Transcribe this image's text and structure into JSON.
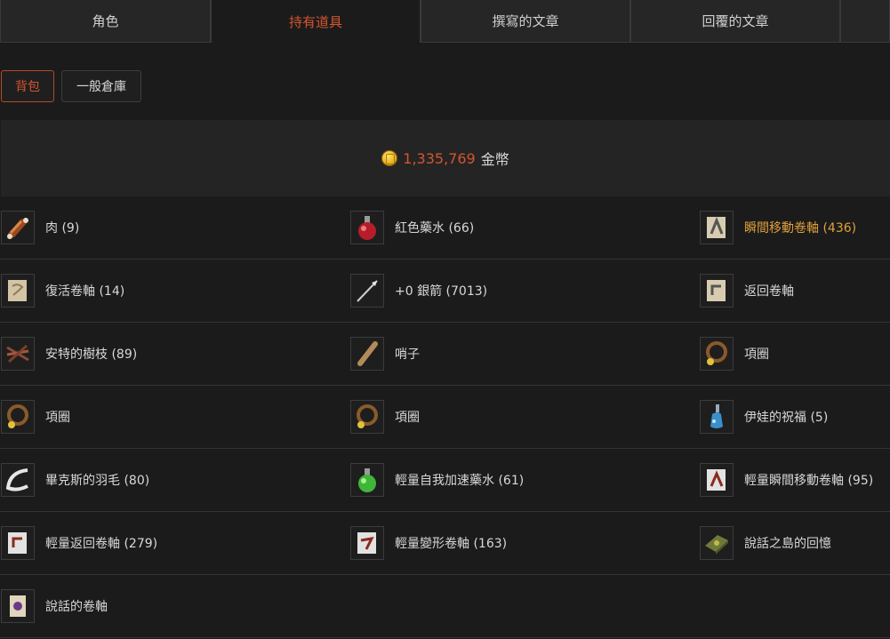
{
  "tabs": [
    "角色",
    "持有道具",
    "撰寫的文章",
    "回覆的文章",
    ""
  ],
  "subtabs": [
    "背包",
    "一般倉庫"
  ],
  "gold": {
    "amount": "1,335,769",
    "unit": "金幣"
  },
  "items": [
    {
      "name": "肉 (9)",
      "icon": "meat-icon"
    },
    {
      "name": "紅色藥水 (66)",
      "icon": "red-potion-icon"
    },
    {
      "name": "瞬間移動卷軸 (436)",
      "icon": "teleport-scroll-icon",
      "highlight": true
    },
    {
      "name": "復活卷軸 (14)",
      "icon": "resurrection-scroll-icon"
    },
    {
      "name": "+0 銀箭 (7013)",
      "icon": "silver-arrow-icon"
    },
    {
      "name": "返回卷軸",
      "icon": "return-scroll-icon"
    },
    {
      "name": "安特的樹枝 (89)",
      "icon": "ent-branch-icon"
    },
    {
      "name": "哨子",
      "icon": "whistle-icon"
    },
    {
      "name": "項圈",
      "icon": "collar-icon"
    },
    {
      "name": "項圈",
      "icon": "collar-icon"
    },
    {
      "name": "項圈",
      "icon": "collar-icon"
    },
    {
      "name": "伊娃的祝福 (5)",
      "icon": "blue-potion-icon"
    },
    {
      "name": "畢克斯的羽毛 (80)",
      "icon": "feather-icon"
    },
    {
      "name": "輕量自我加速藥水 (61)",
      "icon": "green-potion-icon"
    },
    {
      "name": "輕量瞬間移動卷軸 (95)",
      "icon": "light-teleport-scroll-icon"
    },
    {
      "name": "輕量返回卷軸 (279)",
      "icon": "light-return-scroll-icon"
    },
    {
      "name": "輕量變形卷軸 (163)",
      "icon": "polymorph-scroll-icon"
    },
    {
      "name": "說話之島的回憶",
      "icon": "memory-book-icon"
    },
    {
      "name": "說話的卷軸",
      "icon": "talking-scroll-icon"
    }
  ]
}
